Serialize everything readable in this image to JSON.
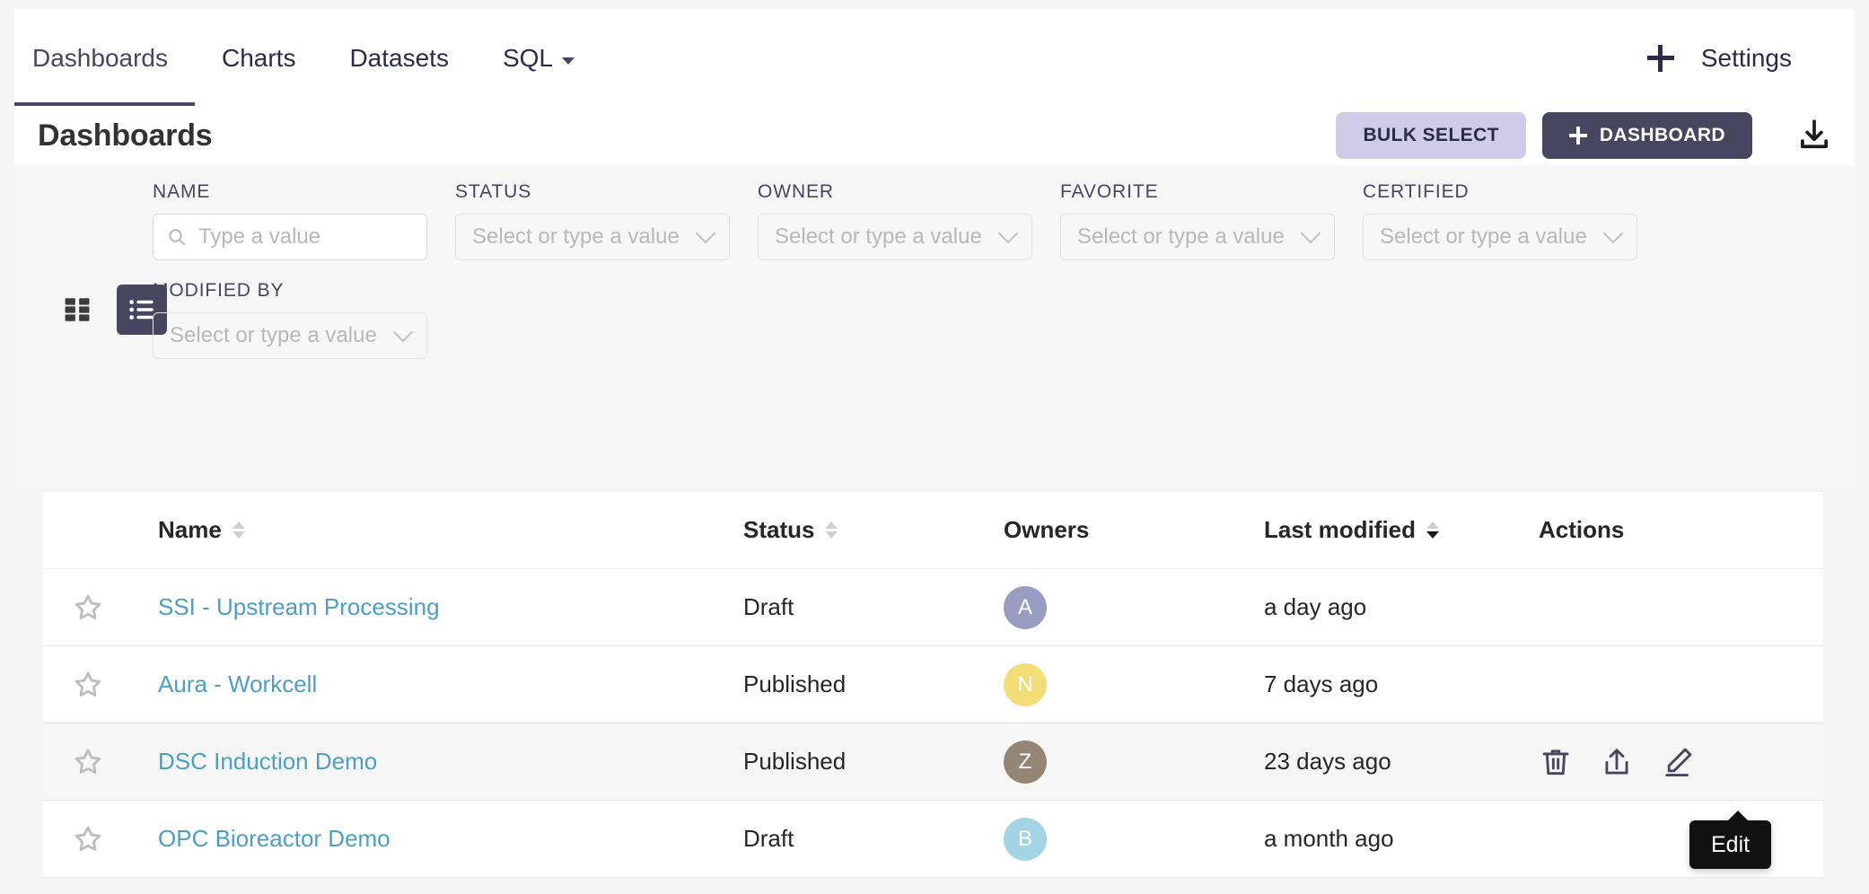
{
  "nav": {
    "items": [
      {
        "label": "Dashboards",
        "active": true,
        "caret": false
      },
      {
        "label": "Charts",
        "active": false,
        "caret": false
      },
      {
        "label": "Datasets",
        "active": false,
        "caret": false
      },
      {
        "label": "SQL",
        "active": false,
        "caret": true
      }
    ],
    "plus_icon": "plus-icon",
    "settings_label": "Settings"
  },
  "header": {
    "title": "Dashboards",
    "bulk_select_label": "BULK SELECT",
    "new_dashboard_label": "DASHBOARD",
    "import_icon": "import-download-icon"
  },
  "view_toggle": {
    "card_icon": "card-grid-view-icon",
    "list_icon": "list-view-icon",
    "active": "list"
  },
  "filters": [
    {
      "label": "NAME",
      "type": "search",
      "value": "",
      "placeholder": "Type a value"
    },
    {
      "label": "STATUS",
      "type": "select",
      "value": "",
      "placeholder": "Select or type a value"
    },
    {
      "label": "OWNER",
      "type": "select",
      "value": "",
      "placeholder": "Select or type a value"
    },
    {
      "label": "FAVORITE",
      "type": "select",
      "value": "",
      "placeholder": "Select or type a value"
    },
    {
      "label": "CERTIFIED",
      "type": "select",
      "value": "",
      "placeholder": "Select or type a value"
    },
    {
      "label": "MODIFIED BY",
      "type": "select",
      "value": "",
      "placeholder": "Select or type a value"
    }
  ],
  "table": {
    "columns": [
      {
        "key": "star",
        "label": "",
        "sortable": false
      },
      {
        "key": "name",
        "label": "Name",
        "sortable": true,
        "sort": "none"
      },
      {
        "key": "status",
        "label": "Status",
        "sortable": true,
        "sort": "none"
      },
      {
        "key": "owners",
        "label": "Owners",
        "sortable": false
      },
      {
        "key": "mod",
        "label": "Last modified",
        "sortable": true,
        "sort": "desc"
      },
      {
        "key": "act",
        "label": "Actions",
        "sortable": false
      }
    ],
    "rows": [
      {
        "favorite": false,
        "name": "SSI - Upstream Processing",
        "status": "Draft",
        "owner_initial": "A",
        "owner_color": "#9a9bc0",
        "last_modified": "a day ago",
        "hovered": false,
        "actions_visible": false
      },
      {
        "favorite": false,
        "name": "Aura - Workcell",
        "status": "Published",
        "owner_initial": "N",
        "owner_color": "#f3dd79",
        "last_modified": "7 days ago",
        "hovered": false,
        "actions_visible": false
      },
      {
        "favorite": false,
        "name": "DSC Induction Demo",
        "status": "Published",
        "owner_initial": "Z",
        "owner_color": "#958574",
        "last_modified": "23 days ago",
        "hovered": true,
        "actions_visible": true
      },
      {
        "favorite": false,
        "name": "OPC Bioreactor Demo",
        "status": "Draft",
        "owner_initial": "B",
        "owner_color": "#a3d4e3",
        "last_modified": "a month ago",
        "hovered": false,
        "actions_visible": false
      }
    ],
    "row_action_icons": [
      "trash-icon",
      "export-icon",
      "edit-pencil-icon"
    ]
  },
  "tooltip": {
    "text": "Edit",
    "for": "edit-pencil-icon"
  },
  "colors": {
    "brand_purple": "#484561",
    "brand_purple_light": "#d0cbe6",
    "link_blue": "#4e9ec4",
    "page_bg": "#f5f5f5",
    "filter_bg": "#f7f7f7",
    "row_hover": "#f6f6f7",
    "tooltip_bg": "#111111"
  }
}
